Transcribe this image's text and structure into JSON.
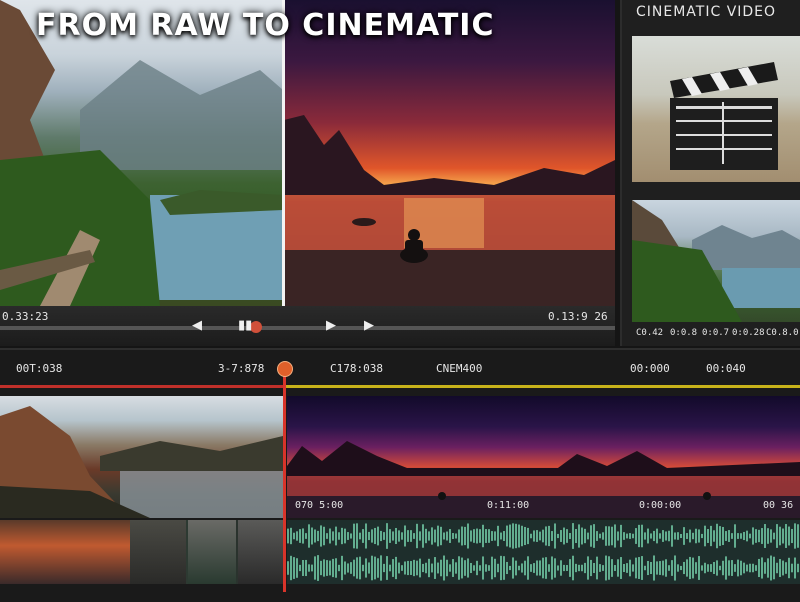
{
  "title": "FROM RAW TO CINEMATIC",
  "preview": {
    "timecode_left": "0.33:23",
    "timecode_right": "0.13:9 26",
    "controls": {
      "rewind_icon": "rewind-icon",
      "play_icon": "play-icon",
      "pause_icon": "pause-icon",
      "forward_icon": "play-icon"
    }
  },
  "panel": {
    "title": "CINEMATIC VIDEO",
    "timecodes": [
      "C0.42",
      "0:0.8",
      "0:0.7",
      "0:0.28",
      "C0.8.0"
    ]
  },
  "timeline": {
    "ruler_labels": [
      "00T:038",
      "3-7:878",
      "C178:038",
      "CNEM400",
      "00:000",
      "00:040"
    ],
    "clip_labels": [
      "070 5:00",
      "0:11:00",
      "0:00:00",
      "00 36"
    ]
  },
  "colors": {
    "accent": "#d8342a",
    "highlight": "#c7b21a",
    "waveform": "#7ad8b0"
  }
}
